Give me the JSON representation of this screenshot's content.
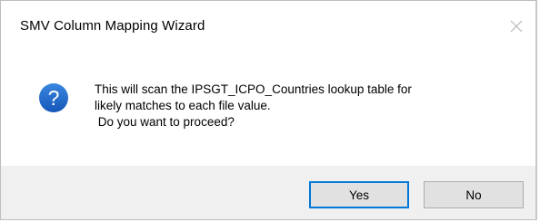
{
  "window": {
    "title": "SMV Column Mapping Wizard",
    "close_icon": "close-icon"
  },
  "message": {
    "icon": "question-icon",
    "line1": "This will scan the IPSGT_ICPO_Countries lookup table for",
    "line2": "likely matches to each file value.",
    "line3": " Do you want to proceed?"
  },
  "buttons": {
    "yes_label": "Yes",
    "no_label": "No"
  },
  "colors": {
    "icon_blue": "#1b64c8",
    "default_button_border": "#0078d7",
    "footer_bg": "#f0f0f0"
  }
}
